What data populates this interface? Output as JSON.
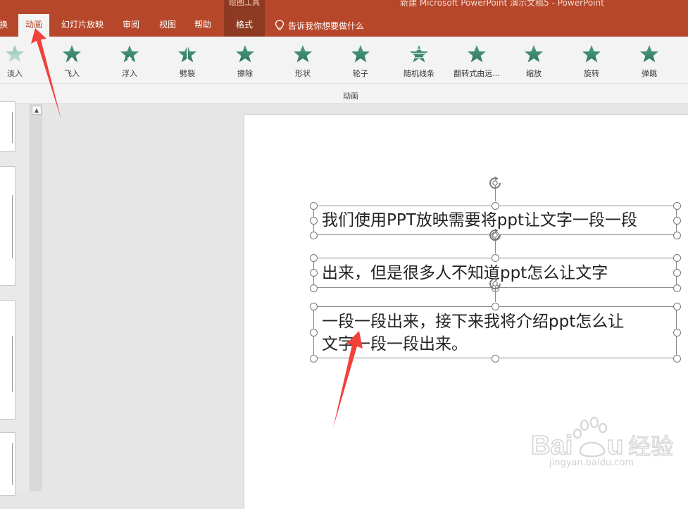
{
  "window": {
    "title": "新建 Microsoft PowerPoint 演示文稿5 - PowerPoint",
    "contextual_group": "绘图工具"
  },
  "tabs": [
    {
      "label": "换",
      "active": false
    },
    {
      "label": "动画",
      "active": true
    },
    {
      "label": "幻灯片放映",
      "active": false
    },
    {
      "label": "审阅",
      "active": false
    },
    {
      "label": "视图",
      "active": false
    },
    {
      "label": "帮助",
      "active": false
    },
    {
      "label": "格式",
      "active": false
    }
  ],
  "tellme": {
    "text": "告诉我你想要做什么",
    "icon": "lightbulb-icon"
  },
  "ribbon": {
    "effects": [
      {
        "label": "淡入",
        "icon": "star-fade-icon"
      },
      {
        "label": "飞入",
        "icon": "star-fly-in-icon"
      },
      {
        "label": "浮入",
        "icon": "star-float-icon"
      },
      {
        "label": "劈裂",
        "icon": "star-split-icon"
      },
      {
        "label": "擦除",
        "icon": "star-wipe-icon"
      },
      {
        "label": "形状",
        "icon": "star-shape-icon"
      },
      {
        "label": "轮子",
        "icon": "star-wheel-icon"
      },
      {
        "label": "随机线条",
        "icon": "star-random-bars-icon"
      },
      {
        "label": "翻转式由远...",
        "icon": "star-grow-turn-icon"
      },
      {
        "label": "缩放",
        "icon": "star-zoom-icon"
      },
      {
        "label": "旋转",
        "icon": "star-swivel-icon"
      },
      {
        "label": "弹跳",
        "icon": "star-bounce-icon"
      }
    ],
    "group_label": "动画"
  },
  "slide": {
    "textboxes": [
      {
        "lines": [
          "我们使用PPT放映需要将ppt让文字一段一段"
        ]
      },
      {
        "lines": [
          "出来，但是很多人不知道ppt怎么让文字"
        ]
      },
      {
        "lines": [
          "一段一段出来，接下来我将介绍ppt怎么让",
          "文字一段一段出来。"
        ]
      }
    ]
  },
  "watermark": {
    "text": "jingyan.baidu.com"
  },
  "colors": {
    "accent": "#b7472a",
    "ribbon_bg": "#f3f3f3",
    "star": "#3f8f74",
    "arrow": "#f0413a"
  }
}
